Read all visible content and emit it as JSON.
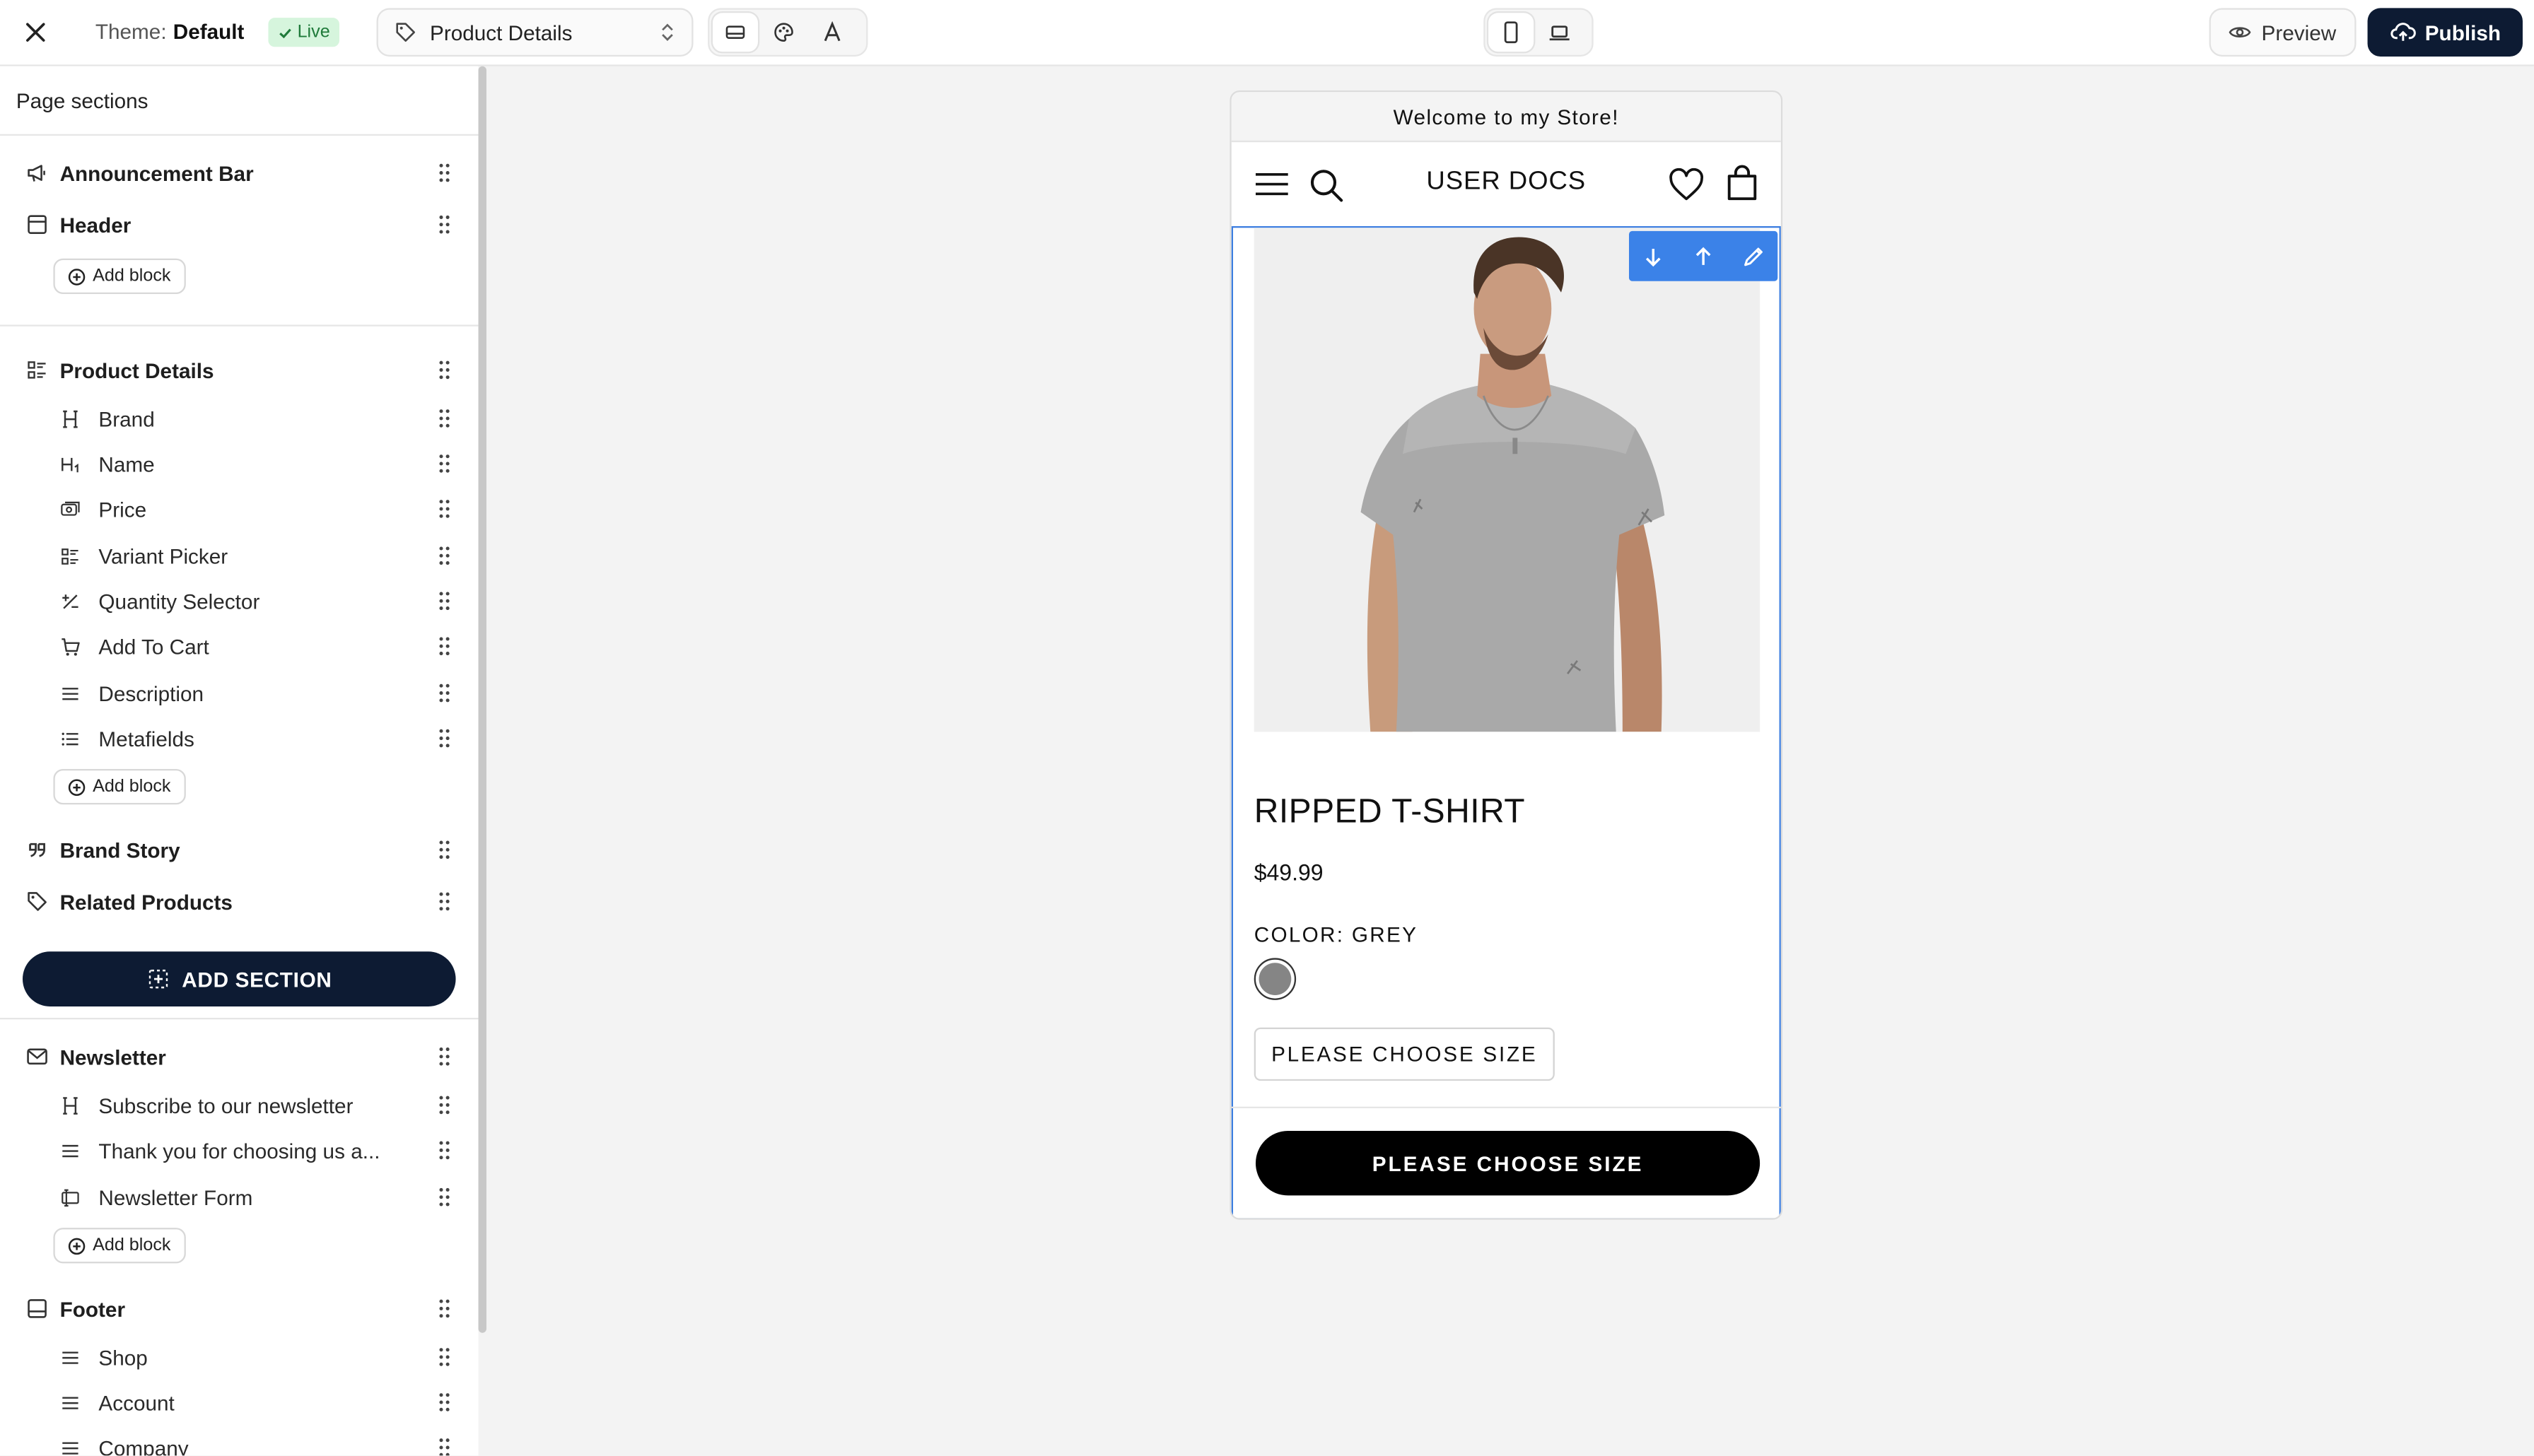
{
  "topbar": {
    "theme_label": "Theme:",
    "theme_value": "Default",
    "live_badge": "Live",
    "template_select": "Product Details",
    "preview_label": "Preview",
    "publish_label": "Publish"
  },
  "sidebar": {
    "title": "Page sections",
    "add_block_label": "Add block",
    "add_section_label": "ADD SECTION",
    "sections": {
      "announcement": {
        "label": "Announcement Bar",
        "icon": "megaphone-icon"
      },
      "header": {
        "label": "Header",
        "icon": "layout-header-icon"
      },
      "product": {
        "label": "Product Details",
        "icon": "list-details-icon",
        "blocks": [
          {
            "label": "Brand",
            "icon": "heading-icon"
          },
          {
            "label": "Name",
            "icon": "heading-1-icon"
          },
          {
            "label": "Price",
            "icon": "price-tag-icon"
          },
          {
            "label": "Variant Picker",
            "icon": "list-details-icon"
          },
          {
            "label": "Quantity Selector",
            "icon": "plus-minus-icon"
          },
          {
            "label": "Add To Cart",
            "icon": "cart-icon"
          },
          {
            "label": "Description",
            "icon": "text-lines-icon"
          },
          {
            "label": "Metafields",
            "icon": "list-icon"
          }
        ]
      },
      "brand_story": {
        "label": "Brand Story",
        "icon": "quote-icon"
      },
      "related": {
        "label": "Related Products",
        "icon": "tags-icon"
      },
      "newsletter": {
        "label": "Newsletter",
        "icon": "mail-icon",
        "blocks": [
          {
            "label": "Subscribe to our newsletter",
            "icon": "heading-icon"
          },
          {
            "label": "Thank you for choosing us a...",
            "icon": "text-lines-icon"
          },
          {
            "label": "Newsletter Form",
            "icon": "form-icon"
          }
        ]
      },
      "footer": {
        "label": "Footer",
        "icon": "layout-footer-icon",
        "blocks": [
          {
            "label": "Shop",
            "icon": "text-lines-icon"
          },
          {
            "label": "Account",
            "icon": "text-lines-icon"
          },
          {
            "label": "Company",
            "icon": "text-lines-icon"
          }
        ]
      }
    }
  },
  "preview": {
    "announcement": "Welcome to my Store!",
    "store_name": "USER DOCS",
    "product_name": "RIPPED T-SHIRT",
    "price": "$49.99",
    "color_label": "COLOR: GREY",
    "size_button": "PLEASE CHOOSE SIZE",
    "cta_button": "PLEASE CHOOSE SIZE",
    "swatch_color": "#858585"
  },
  "colors": {
    "accent": "#3b82e8",
    "primary_dark": "#0d1b33",
    "live_bg": "#d6f5dd",
    "live_text": "#1f7a3a"
  }
}
